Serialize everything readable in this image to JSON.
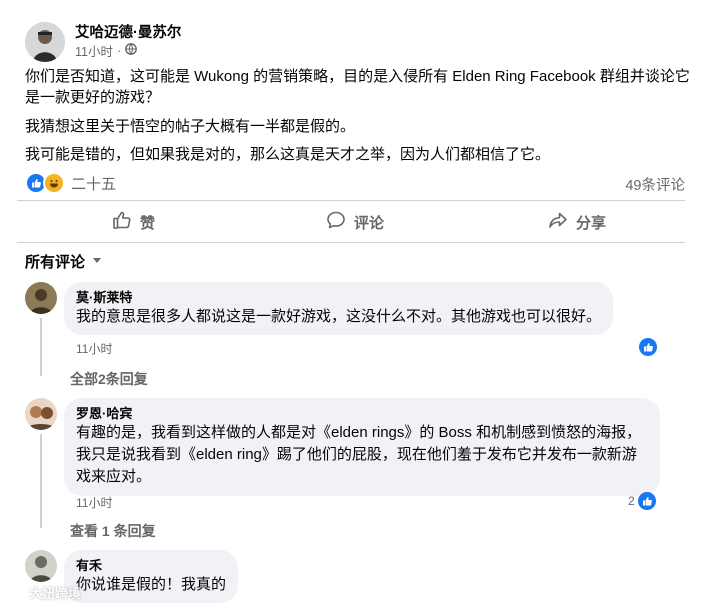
{
  "post": {
    "author": "艾哈迈德·曼苏尔",
    "time": "11小时",
    "paragraphs": [
      "你们是否知道，这可能是 Wukong 的营销策略，目的是入侵所有 Elden Ring Facebook 群组并谈论它是一款更好的游戏？",
      "我猜想这里关于悟空的帖子大概有一半都是假的。",
      "我可能是错的，但如果我是对的，那么这真是天才之举，因为人们都相信了它。"
    ],
    "reaction_count": "二十五",
    "comment_count": "49条评论"
  },
  "actions": {
    "like": "赞",
    "comment": "评论",
    "share": "分享"
  },
  "filter_label": "所有评论",
  "comments": [
    {
      "name": "莫·斯莱特",
      "text": "我的意思是很多人都说这是一款好游戏，这没什么不对。其他游戏也可以很好。",
      "time": "11小时",
      "replies": "全部2条回复"
    },
    {
      "name": "罗恩·哈宾",
      "text": "有趣的是，我看到这样做的人都是对《elden rings》的 Boss 和机制感到愤怒的海报，我只是说我看到《elden ring》踢了他们的屁股，现在他们羞于发布它并发布一款新游戏来应对。",
      "time": "11小时",
      "likes": "2",
      "replies": "查看 1 条回复"
    },
    {
      "name": "有禾",
      "text": "你说谁是假的！我真的"
    }
  ],
  "watermark": "大妞跨境",
  "colors": {
    "brand": "#1877f2",
    "secondary_text": "#65676b",
    "bubble": "#f0f2f5",
    "haha": "#f7b125"
  }
}
